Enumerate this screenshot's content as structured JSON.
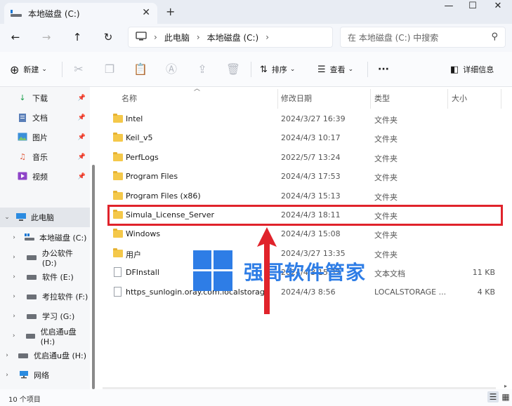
{
  "tab": {
    "title": "本地磁盘 (C:)",
    "close": "✕",
    "new": "+"
  },
  "window": {
    "minimize": "—",
    "maximize": "☐",
    "close": "✕"
  },
  "nav": {
    "back": "←",
    "forward": "→",
    "up": "↑",
    "refresh": "↻",
    "breadcrumb": [
      "此电脑",
      "本地磁盘 (C:)"
    ],
    "search_placeholder": "在 本地磁盘 (C:) 中搜索"
  },
  "toolbar": {
    "new": "新建",
    "sort": "排序",
    "view": "查看",
    "more": "···",
    "details": "详细信息"
  },
  "sidebar": {
    "quick": [
      {
        "label": "下载"
      },
      {
        "label": "文档"
      },
      {
        "label": "图片"
      },
      {
        "label": "音乐"
      },
      {
        "label": "视频"
      }
    ],
    "this_pc": "此电脑",
    "drives": [
      {
        "label": "本地磁盘 (C:)"
      },
      {
        "label": "办公软件 (D:)"
      },
      {
        "label": "软件 (E:)"
      },
      {
        "label": "考拉软件 (F:)"
      },
      {
        "label": "学习 (G:)"
      },
      {
        "label": "优启通u盘 (H:)"
      }
    ],
    "usb": "优启通u盘 (H:)",
    "network": "网络"
  },
  "columns": {
    "name": "名称",
    "date": "修改日期",
    "type": "类型",
    "size": "大小"
  },
  "files": [
    {
      "name": "Intel",
      "date": "2024/3/27 16:39",
      "type": "文件夹",
      "size": "",
      "kind": "folder"
    },
    {
      "name": "Keil_v5",
      "date": "2024/4/3 10:17",
      "type": "文件夹",
      "size": "",
      "kind": "folder"
    },
    {
      "name": "PerfLogs",
      "date": "2022/5/7 13:24",
      "type": "文件夹",
      "size": "",
      "kind": "folder"
    },
    {
      "name": "Program Files",
      "date": "2024/4/3 17:53",
      "type": "文件夹",
      "size": "",
      "kind": "folder"
    },
    {
      "name": "Program Files (x86)",
      "date": "2024/4/3 15:13",
      "type": "文件夹",
      "size": "",
      "kind": "folder"
    },
    {
      "name": "Simula_License_Server",
      "date": "2024/4/3 18:11",
      "type": "文件夹",
      "size": "",
      "kind": "folder"
    },
    {
      "name": "Windows",
      "date": "2024/4/3 15:08",
      "type": "文件夹",
      "size": "",
      "kind": "folder"
    },
    {
      "name": "用户",
      "date": "2024/3/27 13:35",
      "type": "文件夹",
      "size": "",
      "kind": "folder"
    },
    {
      "name": "DFInstall",
      "date": "2024/4/3 15:32",
      "type": "文本文档",
      "size": "11 KB",
      "kind": "file"
    },
    {
      "name": "https_sunlogin.oray.com.localstorage",
      "date": "2024/4/3 8:56",
      "type": "LOCALSTORAGE ...",
      "size": "4 KB",
      "kind": "file"
    }
  ],
  "watermark": "强哥软件管家",
  "status": {
    "count": "10 个项目"
  },
  "colors": {
    "highlight": "#e0232b",
    "watermark": "#2e7de6",
    "folder": "#f4c84a"
  }
}
